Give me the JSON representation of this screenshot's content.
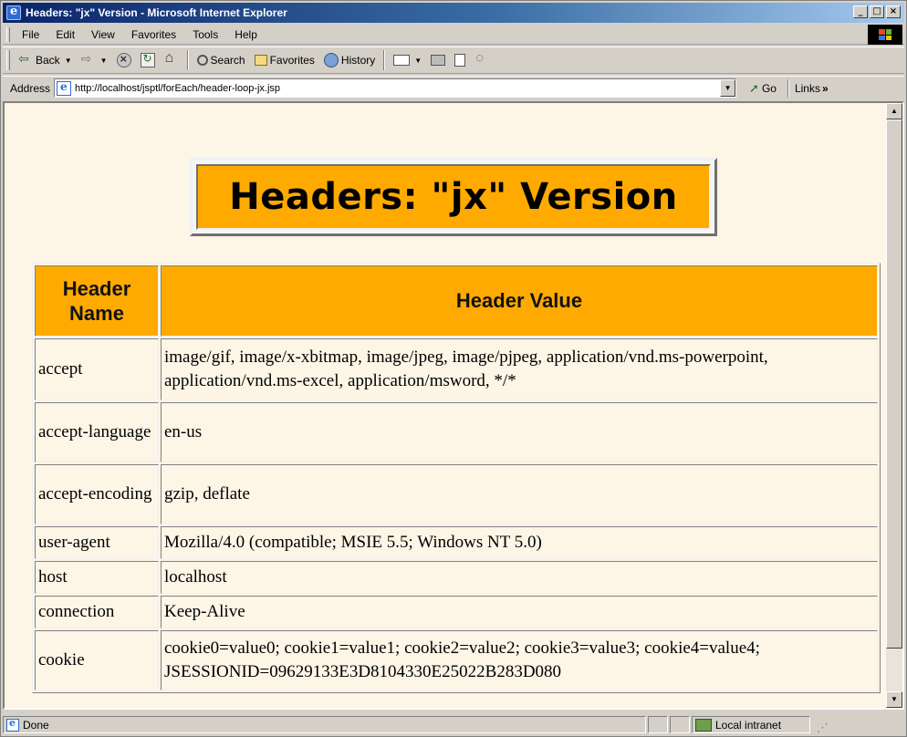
{
  "window": {
    "title": "Headers: \"jx\" Version - Microsoft Internet Explorer",
    "buttons": {
      "minimize": "_",
      "maximize": "□",
      "close": "×"
    }
  },
  "menu": [
    "File",
    "Edit",
    "View",
    "Favorites",
    "Tools",
    "Help"
  ],
  "toolbar": {
    "back": "Back",
    "search": "Search",
    "favorites": "Favorites",
    "history": "History"
  },
  "address": {
    "label": "Address",
    "url": "http://localhost/jsptl/forEach/header-loop-jx.jsp",
    "go": "Go",
    "links": "Links",
    "links_chevron": "»"
  },
  "page": {
    "heading": "Headers: \"jx\" Version",
    "table": {
      "columns": [
        "Header Name",
        "Header Value"
      ],
      "rows": [
        {
          "name": "accept",
          "value": "image/gif, image/x-xbitmap, image/jpeg, image/pjpeg, application/vnd.ms-powerpoint, application/vnd.ms-excel, application/msword, */*"
        },
        {
          "name": "accept-language",
          "value": "en-us"
        },
        {
          "name": "accept-encoding",
          "value": "gzip, deflate"
        },
        {
          "name": "user-agent",
          "value": "Mozilla/4.0 (compatible; MSIE 5.5; Windows NT 5.0)"
        },
        {
          "name": "host",
          "value": "localhost"
        },
        {
          "name": "connection",
          "value": "Keep-Alive"
        },
        {
          "name": "cookie",
          "value": "cookie0=value0; cookie1=value1; cookie2=value2; cookie3=value3; cookie4=value4; JSESSIONID=09629133E3D8104330E25022B283D080"
        }
      ]
    }
  },
  "status": {
    "text": "Done",
    "zone": "Local intranet"
  },
  "colors": {
    "accent": "#ffaa00",
    "page_background": "#fdf5e6",
    "chrome": "#d4d0c8"
  }
}
